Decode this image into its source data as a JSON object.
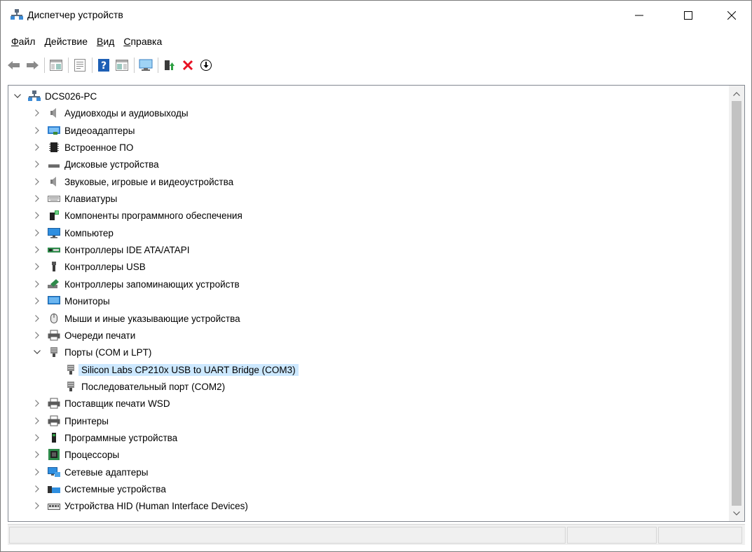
{
  "window": {
    "title": "Диспетчер устройств"
  },
  "menu": {
    "items": [
      {
        "accel": "Ф",
        "rest": "айл"
      },
      {
        "accel": "Д",
        "rest": "ействие"
      },
      {
        "accel": "В",
        "rest": "ид"
      },
      {
        "accel": "С",
        "rest": "правка"
      }
    ]
  },
  "toolbar": {
    "buttons": [
      "back-icon",
      "forward-icon",
      "show-hide-console-tree-icon",
      "properties-icon",
      "help-icon",
      "view-icon",
      "scan-hardware-icon",
      "update-driver-icon",
      "uninstall-icon",
      "disable-device-icon"
    ]
  },
  "tree": {
    "root": "DCS026-PC",
    "categories": [
      {
        "label": "Аудиовходы и аудиовыходы",
        "icon": "speaker-icon"
      },
      {
        "label": "Видеоадаптеры",
        "icon": "display-adapter-icon"
      },
      {
        "label": "Встроенное ПО",
        "icon": "firmware-icon"
      },
      {
        "label": "Дисковые устройства",
        "icon": "disk-drive-icon"
      },
      {
        "label": "Звуковые, игровые и видеоустройства",
        "icon": "speaker-icon"
      },
      {
        "label": "Клавиатуры",
        "icon": "keyboard-icon"
      },
      {
        "label": "Компоненты программного обеспечения",
        "icon": "software-component-icon"
      },
      {
        "label": "Компьютер",
        "icon": "computer-icon"
      },
      {
        "label": "Контроллеры IDE ATA/ATAPI",
        "icon": "ide-controller-icon"
      },
      {
        "label": "Контроллеры USB",
        "icon": "usb-icon"
      },
      {
        "label": "Контроллеры запоминающих устройств",
        "icon": "storage-controller-icon"
      },
      {
        "label": "Мониторы",
        "icon": "monitor-icon"
      },
      {
        "label": "Мыши и иные указывающие устройства",
        "icon": "mouse-icon"
      },
      {
        "label": "Очереди печати",
        "icon": "printer-icon"
      },
      {
        "label": "Порты (COM и LPT)",
        "icon": "port-icon",
        "expanded": true
      },
      {
        "label": "Silicon Labs CP210x USB to UART Bridge (COM3)",
        "icon": "port-icon",
        "child": true,
        "selected": true
      },
      {
        "label": "Последовательный порт (COM2)",
        "icon": "port-icon",
        "child": true
      },
      {
        "label": "Поставщик печати WSD",
        "icon": "printer-icon"
      },
      {
        "label": "Принтеры",
        "icon": "printer-icon"
      },
      {
        "label": "Программные устройства",
        "icon": "software-device-icon"
      },
      {
        "label": "Процессоры",
        "icon": "processor-icon"
      },
      {
        "label": "Сетевые адаптеры",
        "icon": "network-adapter-icon"
      },
      {
        "label": "Системные устройства",
        "icon": "system-device-icon"
      },
      {
        "label": "Устройства HID (Human Interface Devices)",
        "icon": "hid-icon"
      }
    ]
  },
  "colors": {
    "selection": "#cce8ff",
    "uninstall_red": "#e81123",
    "help_blue": "#1d5fb5"
  }
}
